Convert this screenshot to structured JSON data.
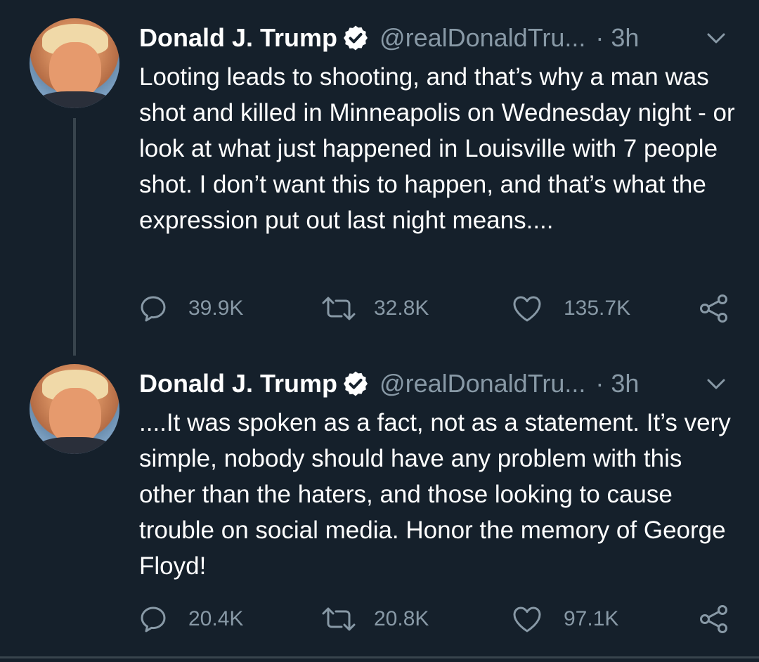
{
  "tweets": [
    {
      "name": "Donald J. Trump",
      "handle": "@realDonaldTru...",
      "separator": "·",
      "time": "3h",
      "text": "Looting leads to shooting, and that’s why a man was shot and killed in Minneapolis on Wednesday night - or look at what just happened in Louisville with 7 people shot. I don’t want this to happen, and that’s what the expression put out last night means....",
      "replies": "39.9K",
      "retweets": "32.8K",
      "likes": "135.7K"
    },
    {
      "name": "Donald J. Trump",
      "handle": "@realDonaldTru...",
      "separator": "·",
      "time": "3h",
      "text": "....It was spoken as a fact, not as a statement. It’s very simple, nobody should have any problem with this other than the haters, and those looking to cause trouble on social media. Honor the memory of George Floyd!",
      "replies": "20.4K",
      "retweets": "20.8K",
      "likes": "97.1K"
    }
  ],
  "icons": {
    "verified": "verified-badge-icon",
    "caret": "chevron-down-icon",
    "reply": "reply-icon",
    "retweet": "retweet-icon",
    "like": "heart-icon",
    "share": "share-icon"
  },
  "colors": {
    "background": "#15202b",
    "text": "#ffffff",
    "secondary_text": "#8899a6",
    "divider": "#38444d"
  }
}
